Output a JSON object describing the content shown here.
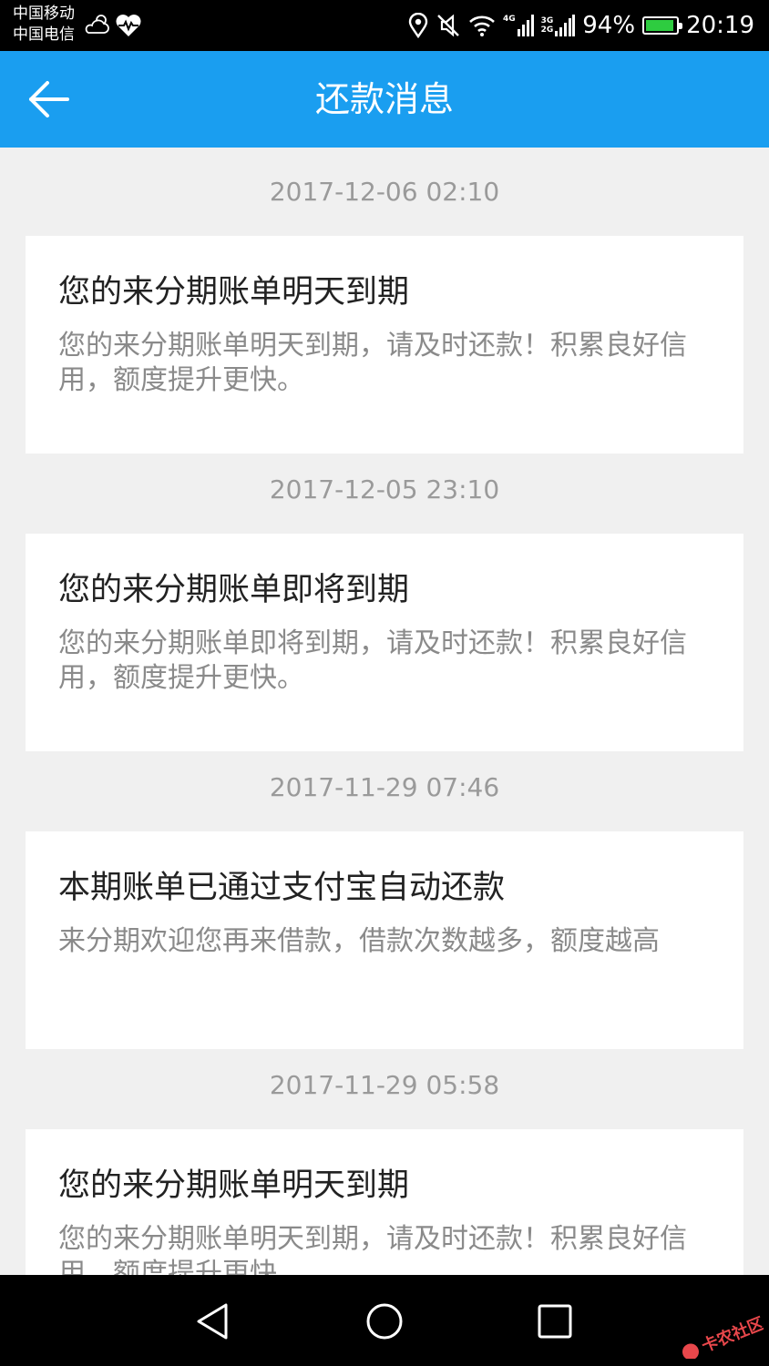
{
  "status_bar": {
    "carrier_1": "中国移动",
    "carrier_2": "中国电信",
    "network_1": "4G",
    "network_2a": "3G",
    "network_2b": "2G",
    "battery": "94%",
    "time": "20:19"
  },
  "header": {
    "title": "还款消息",
    "back_icon": "arrow-left-icon",
    "background": "#1a9ef0"
  },
  "messages": [
    {
      "time": "2017-12-06 02:10",
      "title": "您的来分期账单明天到期",
      "body": "您的来分期账单明天到期，请及时还款！积累良好信用，额度提升更快。"
    },
    {
      "time": "2017-12-05 23:10",
      "title": "您的来分期账单即将到期",
      "body": "您的来分期账单即将到期，请及时还款！积累良好信用，额度提升更快。"
    },
    {
      "time": "2017-11-29 07:46",
      "title": "本期账单已通过支付宝自动还款",
      "body": "来分期欢迎您再来借款，借款次数越多，额度越高"
    },
    {
      "time": "2017-11-29 05:58",
      "title": "您的来分期账单明天到期",
      "body": "您的来分期账单明天到期，请及时还款！积累良好信用，额度提升更快。"
    }
  ],
  "nav_bar": {
    "icons": [
      "nav-back-icon",
      "nav-home-icon",
      "nav-recent-icon"
    ]
  },
  "watermark": {
    "text": "卡农社区",
    "color": "#e8474b"
  }
}
